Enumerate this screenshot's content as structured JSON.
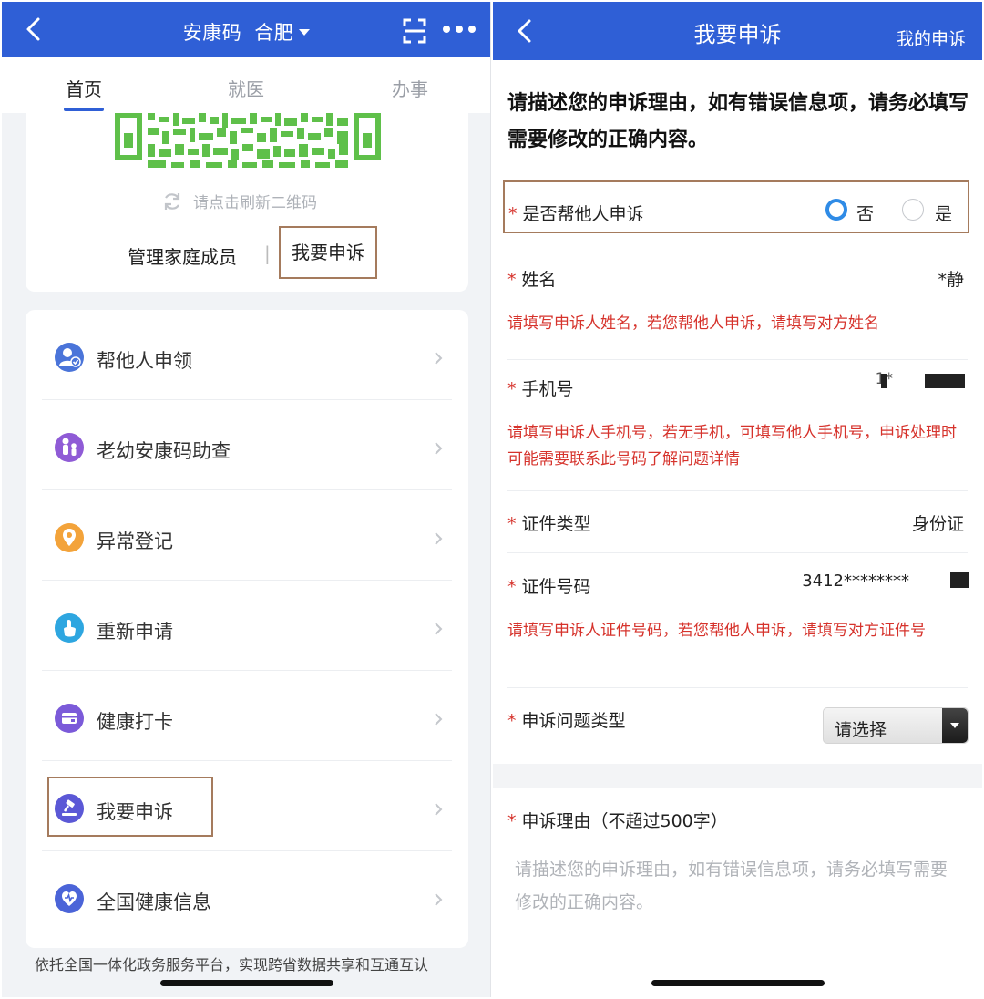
{
  "left": {
    "header": {
      "title": "安康码",
      "city": "合肥"
    },
    "tabs": [
      "首页",
      "就医",
      "办事"
    ],
    "qr": {
      "refresh_text": "请点击刷新二维码",
      "family_link": "管理家庭成员",
      "separator": "|",
      "appeal_link": "我要申诉"
    },
    "menu": [
      {
        "label": "帮他人申领",
        "icon": "person-check-icon",
        "color": "#4a74d9"
      },
      {
        "label": "老幼安康码助查",
        "icon": "family-icon",
        "color": "#8f5bd6"
      },
      {
        "label": "异常登记",
        "icon": "location-pin-icon",
        "color": "#f3a33a"
      },
      {
        "label": "重新申请",
        "icon": "touch-hand-icon",
        "color": "#2ea6e0"
      },
      {
        "label": "健康打卡",
        "icon": "card-icon",
        "color": "#7b5ad9"
      },
      {
        "label": "我要申诉",
        "icon": "gavel-icon",
        "color": "#5b58d6"
      },
      {
        "label": "全国健康信息",
        "icon": "heart-shield-icon",
        "color": "#4b64d8"
      }
    ],
    "footer": "依托全国一体化政务服务平台，实现跨省数据共享和互通互认"
  },
  "right": {
    "header": {
      "title": "我要申诉",
      "my_appeal": "我的申诉"
    },
    "intro": "请描述您的申诉理由，如有错误信息项，请务必填写需要修改的正确内容。",
    "required_mark": "*",
    "help_other": {
      "label": "是否帮他人申诉",
      "option_no": "否",
      "option_yes": "是",
      "selected": "否"
    },
    "name": {
      "label": "姓名",
      "value": "*静",
      "hint": "请填写申诉人姓名，若您帮他人申诉，请填写对方姓名"
    },
    "phone": {
      "label": "手机号",
      "value": "1*",
      "hint": "请填写申诉人手机号，若无手机，可填写他人手机号，申诉处理时可能需要联系此号码了解问题详情"
    },
    "id_type": {
      "label": "证件类型",
      "value": "身份证"
    },
    "id_number": {
      "label": "证件号码",
      "value": "3412********",
      "hint": "请填写申诉人证件号码，若您帮他人申诉，请填写对方证件号"
    },
    "issue_type": {
      "label": "申诉问题类型",
      "value": "请选择"
    },
    "reason": {
      "label": "申诉理由（不超过500字）",
      "placeholder": "请描述您的申诉理由，如有错误信息项，请务必填写需要修改的正确内容。"
    }
  },
  "colors": {
    "brand_blue": "#2f5fd6",
    "required_red": "#d6332c",
    "highlight_box": "#a57b5d",
    "qr_green": "#5fc04a"
  }
}
